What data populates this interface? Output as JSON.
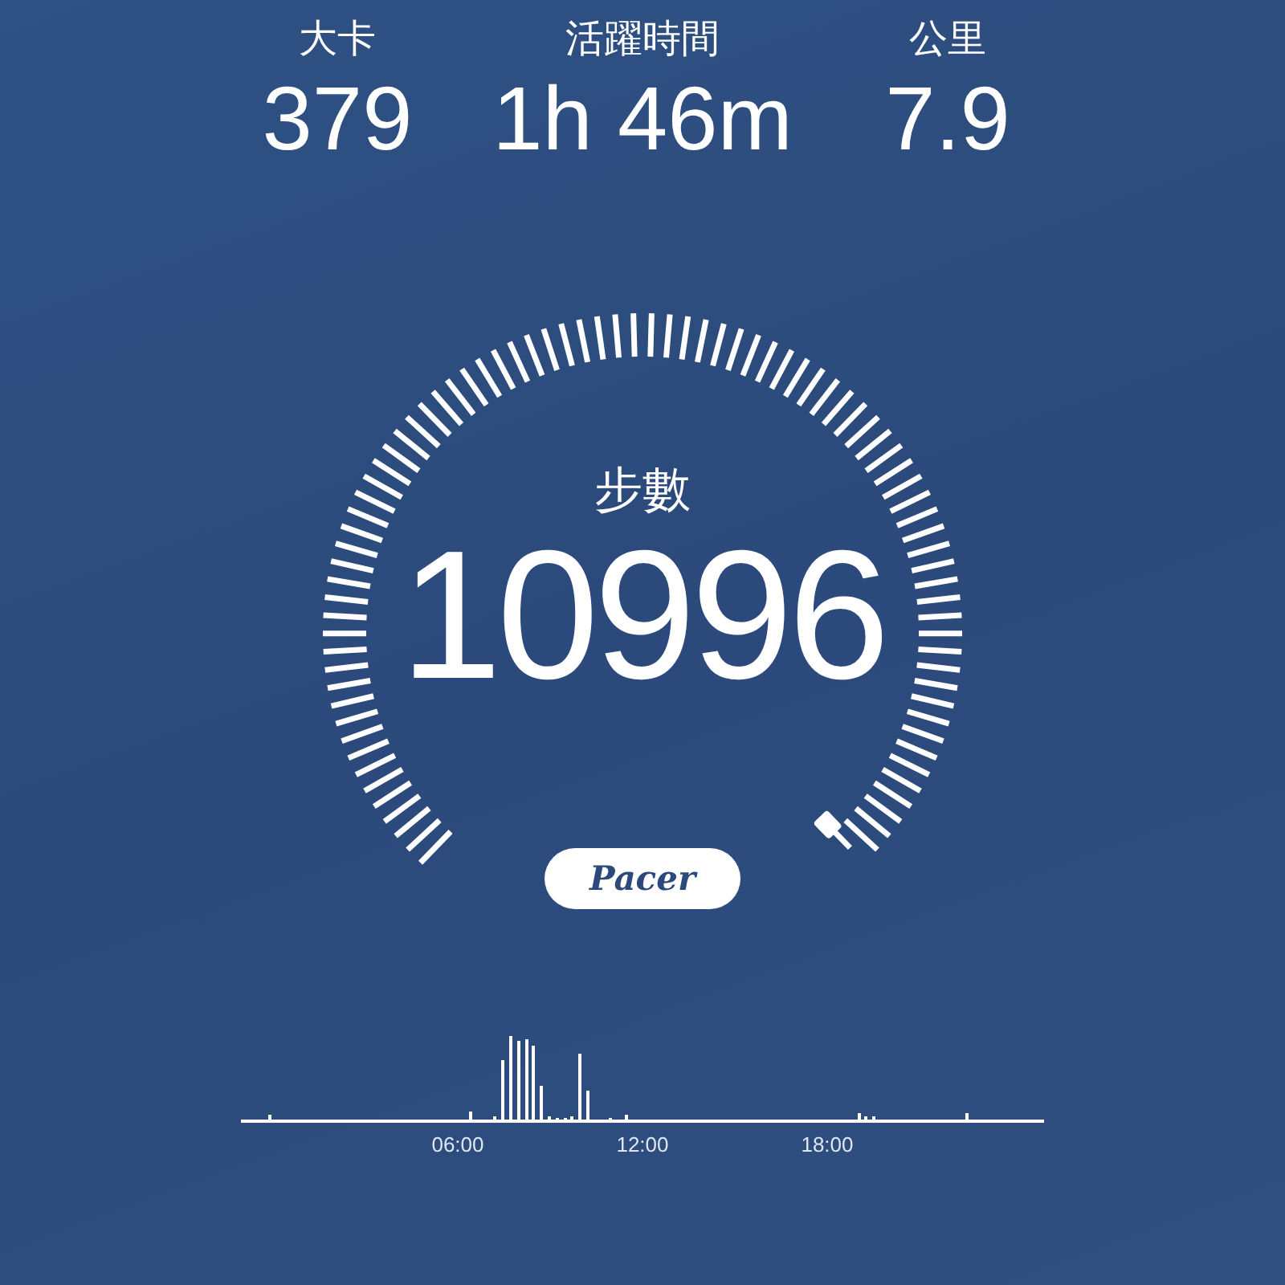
{
  "stats": [
    {
      "label": "大卡",
      "value": "379"
    },
    {
      "label": "活躍時間",
      "value": "1h 46m"
    },
    {
      "label": "公里",
      "value": "7.9"
    }
  ],
  "gauge": {
    "label": "步數",
    "value": "10996"
  },
  "brand": {
    "text": "Pacer"
  },
  "activity_chart": {
    "axis_labels": [
      "06:00",
      "12:00",
      "18:00"
    ]
  }
}
